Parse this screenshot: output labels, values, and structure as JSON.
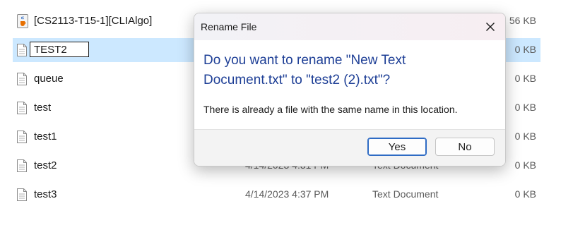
{
  "files": [
    {
      "name": "[CS2113-T15-1][CLIAlgo]",
      "date": "",
      "type": "",
      "size": "56 KB",
      "icon": "java-icon"
    },
    {
      "name": "TEST2",
      "date": "",
      "type": "",
      "size": "0 KB",
      "icon": "text-file-icon",
      "editing": true
    },
    {
      "name": "queue",
      "date": "",
      "type": "",
      "size": "0 KB",
      "icon": "text-file-icon"
    },
    {
      "name": "test",
      "date": "",
      "type": "",
      "size": "0 KB",
      "icon": "text-file-icon"
    },
    {
      "name": "test1",
      "date": "",
      "type": "",
      "size": "0 KB",
      "icon": "text-file-icon"
    },
    {
      "name": "test2",
      "date": "4/14/2023 4:31 PM",
      "type": "Text Document",
      "size": "0 KB",
      "icon": "text-file-icon"
    },
    {
      "name": "test3",
      "date": "4/14/2023 4:37 PM",
      "type": "Text Document",
      "size": "0 KB",
      "icon": "text-file-icon"
    }
  ],
  "dialog": {
    "title": "Rename File",
    "heading": "Do you want to rename \"New Text Document.txt\" to \"test2 (2).txt\"?",
    "message": "There is already a file with the same name in this location.",
    "yes_label": "Yes",
    "no_label": "No"
  },
  "colors": {
    "selection": "#cce8ff",
    "heading": "#1e3f96",
    "primary_border": "#2e6bc4"
  }
}
